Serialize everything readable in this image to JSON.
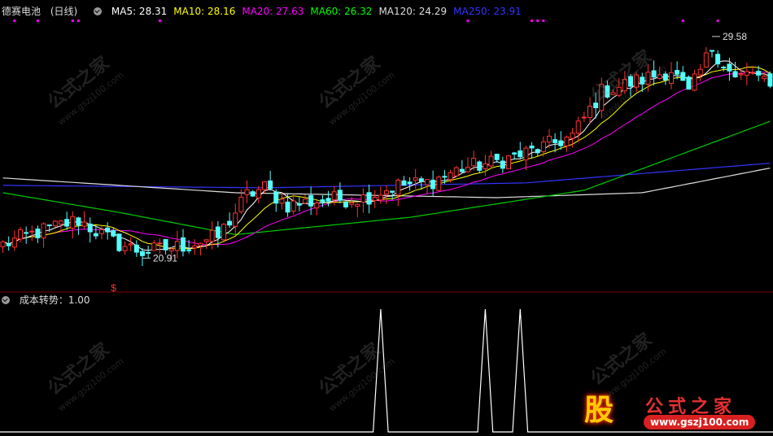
{
  "header": {
    "stock": "德赛电池",
    "period": "(日线)",
    "ma": [
      {
        "label": "MA5: 28.31",
        "color": "#ffffff"
      },
      {
        "label": "MA10: 28.16",
        "color": "#ffff00"
      },
      {
        "label": "MA20: 27.63",
        "color": "#ff00ff"
      },
      {
        "label": "MA60: 26.32",
        "color": "#00ff00"
      },
      {
        "label": "MA120: 24.29",
        "color": "#dddddd"
      },
      {
        "label": "MA250: 23.91",
        "color": "#3333ff"
      }
    ]
  },
  "indicator": {
    "label": "成本转势：1.00"
  },
  "watermark": {
    "text": "公式之家",
    "url": "www.gszj100.com"
  },
  "logo": {
    "glyph": "股",
    "name": "公式之家",
    "url": "www.gszj100.com"
  },
  "chart_data": [
    {
      "type": "candlestick",
      "title": "德赛电池 (日线)",
      "n": 133,
      "ylim": [
        19.5,
        30.5
      ],
      "annotations": [
        {
          "index": 24,
          "price": 20.91,
          "label": "20.91",
          "kind": "low"
        },
        {
          "index": 122,
          "price": 29.58,
          "label": "29.58",
          "kind": "high"
        }
      ],
      "signal_marks": [
        {
          "index": 19,
          "label": "$"
        }
      ],
      "top_markers": [
        2,
        6,
        12,
        13,
        27,
        80,
        91,
        92,
        93,
        117,
        123
      ],
      "keypoints": [
        [
          0,
          21.3
        ],
        [
          6,
          21.8
        ],
        [
          13,
          22.3
        ],
        [
          19,
          21.4
        ],
        [
          24,
          21.0
        ],
        [
          30,
          21.2
        ],
        [
          37,
          21.6
        ],
        [
          42,
          23.3
        ],
        [
          45,
          23.6
        ],
        [
          49,
          22.9
        ],
        [
          55,
          23.1
        ],
        [
          62,
          23.2
        ],
        [
          68,
          23.7
        ],
        [
          73,
          23.8
        ],
        [
          79,
          24.4
        ],
        [
          84,
          24.6
        ],
        [
          90,
          25.0
        ],
        [
          98,
          25.7
        ],
        [
          103,
          27.5
        ],
        [
          110,
          28.0
        ],
        [
          115,
          28.4
        ],
        [
          118,
          27.4
        ],
        [
          122,
          29.3
        ],
        [
          126,
          28.0
        ],
        [
          129,
          28.3
        ],
        [
          132,
          27.6
        ]
      ],
      "ma_lines": [
        {
          "name": "MA5",
          "color": "#ffffff"
        },
        {
          "name": "MA10",
          "color": "#ffff00"
        },
        {
          "name": "MA20",
          "color": "#ff00ff"
        },
        {
          "name": "MA60",
          "color": "#00ff00"
        },
        {
          "name": "MA120",
          "color": "#dddddd"
        },
        {
          "name": "MA250",
          "color": "#3333ff"
        }
      ],
      "ma250_points": [
        [
          0,
          23.7
        ],
        [
          45,
          23.6
        ],
        [
          90,
          23.8
        ],
        [
          132,
          24.6
        ]
      ],
      "ma120_points": [
        [
          0,
          24.0
        ],
        [
          40,
          23.4
        ],
        [
          85,
          23.2
        ],
        [
          110,
          23.4
        ],
        [
          132,
          24.4
        ]
      ],
      "ma60_points": [
        [
          0,
          23.4
        ],
        [
          20,
          22.6
        ],
        [
          40,
          21.7
        ],
        [
          70,
          22.4
        ],
        [
          100,
          23.5
        ],
        [
          132,
          26.3
        ]
      ]
    },
    {
      "type": "line",
      "title": "成本转势：1.00",
      "ylim": [
        0,
        1
      ],
      "spikes": [
        {
          "index": 65,
          "value": 1
        },
        {
          "index": 83,
          "value": 1
        },
        {
          "index": 89,
          "value": 1
        }
      ]
    }
  ]
}
